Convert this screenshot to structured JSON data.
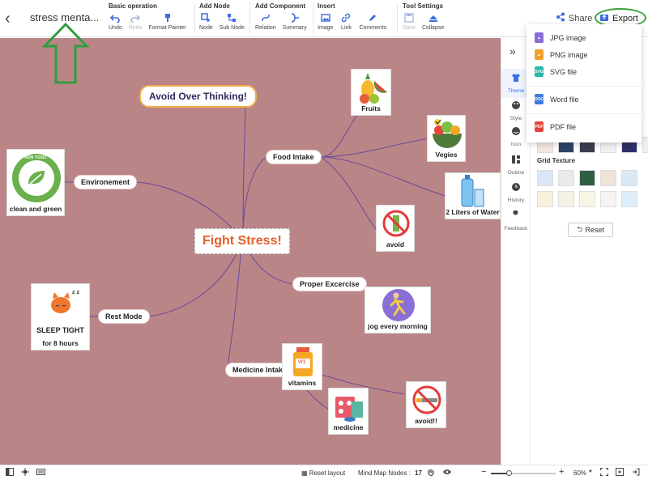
{
  "header": {
    "back_label": "‹",
    "doc_title": "stress menta...",
    "groups": [
      {
        "title": "Basic operation",
        "tools": [
          {
            "label": "Undo",
            "icon": "undo-icon"
          },
          {
            "label": "Redo",
            "icon": "redo-icon"
          },
          {
            "label": "Format Painter",
            "icon": "format-painter-icon"
          }
        ]
      },
      {
        "title": "Add Node",
        "tools": [
          {
            "label": "Node",
            "icon": "node-icon"
          },
          {
            "label": "Sub Node",
            "icon": "sub-node-icon"
          }
        ]
      },
      {
        "title": "Add Component",
        "tools": [
          {
            "label": "Relation",
            "icon": "relation-icon"
          },
          {
            "label": "Summary",
            "icon": "summary-icon"
          }
        ]
      },
      {
        "title": "Insert",
        "tools": [
          {
            "label": "Image",
            "icon": "image-icon"
          },
          {
            "label": "Link",
            "icon": "link-icon"
          },
          {
            "label": "Comments",
            "icon": "comments-icon"
          }
        ]
      },
      {
        "title": "Tool Settings",
        "tools": [
          {
            "label": "Save",
            "icon": "save-icon"
          },
          {
            "label": "Collapse",
            "icon": "collapse-icon"
          }
        ]
      }
    ],
    "share_label": "Share",
    "export_label": "Export"
  },
  "export_menu": {
    "items": [
      {
        "label": "JPG image",
        "badge": "",
        "color": "#8b6bd8"
      },
      {
        "label": "PNG image",
        "badge": "",
        "color": "#f0a030"
      },
      {
        "label": "SVG file",
        "badge": "SVG",
        "color": "#2cb6a8"
      },
      {
        "label": "Word file",
        "badge": "DOC",
        "color": "#3d7be0"
      },
      {
        "label": "PDF file",
        "badge": "PDF",
        "color": "#e0453d"
      }
    ]
  },
  "mindmap": {
    "central": "Fight Stress!",
    "floating_topic": "Avoid Over Thinking!",
    "branches": {
      "food_intake": "Food Intake",
      "environment": "Environement",
      "proper_exercise": "Proper Excercise",
      "rest_mode": "Rest Mode",
      "medicine_intake": "Medicine Intake"
    },
    "images": {
      "fruits": "Fruits",
      "vegies": "Vegies",
      "water": "2 Liters of Water",
      "avoid": "avoid",
      "clean_green": "clean and green",
      "non_toxic": "NON TOXIC",
      "jog": "jog every morning",
      "sleep_tight": "SLEEP TIGHT",
      "for_8_hours": "for 8 hours",
      "vitamins": "vitamins",
      "vit_label": "VIT.",
      "medicine": "medicine",
      "avoid2": "avoid!!"
    },
    "colors": {
      "canvas": "#b98586",
      "central_text": "#e3612b",
      "lines": "#6b4a9a"
    }
  },
  "sidebar": {
    "collapse_icon": "»",
    "items": [
      {
        "label": "Theme",
        "icon": "shirt-icon"
      },
      {
        "label": "Style",
        "icon": "palette-icon"
      },
      {
        "label": "Icon",
        "icon": "smiley-icon"
      },
      {
        "label": "Outline",
        "icon": "outline-icon"
      },
      {
        "label": "History",
        "icon": "history-icon"
      },
      {
        "label": "Feedback",
        "icon": "wrench-icon"
      }
    ]
  },
  "panel": {
    "grid_texture_title": "Grid Texture",
    "reset_label": "Reset",
    "top_swatches": [
      "#f3e6df",
      "#2f4366",
      "#3a3f4e",
      "#f2f2f2",
      "#2e2f6b",
      "#eeeeee"
    ],
    "texture_swatches": [
      "#d8e6f5",
      "#eaeaea",
      "#2f5e45",
      "#f1e3d8",
      "#d9e9f5",
      "#f7f0dc",
      "#f5f1e5",
      "#f9f5e6",
      "#f4f4f4",
      "#ddeefa"
    ]
  },
  "statusbar": {
    "reset_layout": "Reset layout",
    "nodes_label": "Mind Map Nodes :",
    "nodes_count": "17",
    "zoom": "60%",
    "zoom_minus": "−",
    "zoom_plus": "+",
    "zoom_fraction": 0.6
  }
}
